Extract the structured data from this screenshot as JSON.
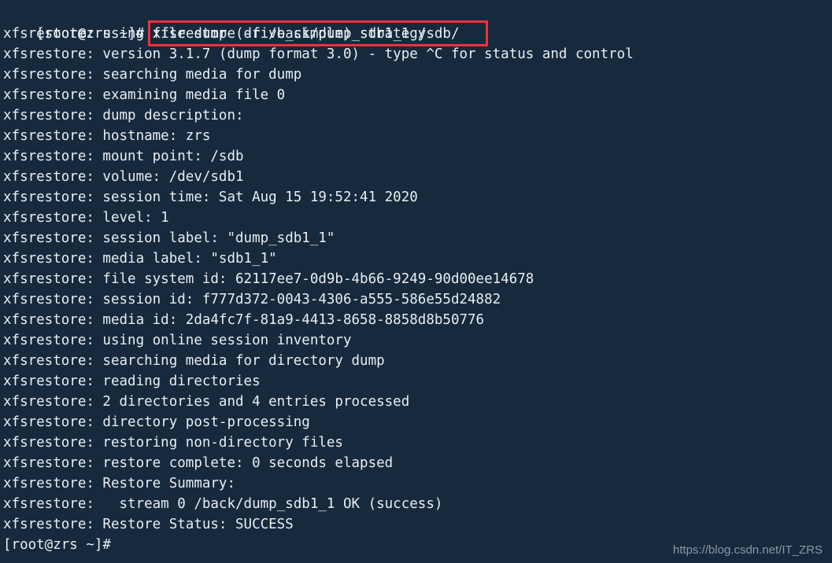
{
  "terminal": {
    "background_color": "#17293d",
    "text_color": "#e8eef2",
    "highlight_box_color": "#f3303c",
    "prompt": "[root@zrs ~]# ",
    "command": "xfsrestore -f /back/dump_sdb1_1 /sdb/",
    "output_lines": [
      "xfsrestore: using file dump (drive_simple) strategy",
      "xfsrestore: version 3.1.7 (dump format 3.0) - type ^C for status and control",
      "xfsrestore: searching media for dump",
      "xfsrestore: examining media file 0",
      "xfsrestore: dump description:",
      "xfsrestore: hostname: zrs",
      "xfsrestore: mount point: /sdb",
      "xfsrestore: volume: /dev/sdb1",
      "xfsrestore: session time: Sat Aug 15 19:52:41 2020",
      "xfsrestore: level: 1",
      "xfsrestore: session label: \"dump_sdb1_1\"",
      "xfsrestore: media label: \"sdb1_1\"",
      "xfsrestore: file system id: 62117ee7-0d9b-4b66-9249-90d00ee14678",
      "xfsrestore: session id: f777d372-0043-4306-a555-586e55d24882",
      "xfsrestore: media id: 2da4fc7f-81a9-4413-8658-8858d8b50776",
      "xfsrestore: using online session inventory",
      "xfsrestore: searching media for directory dump",
      "xfsrestore: reading directories",
      "xfsrestore: 2 directories and 4 entries processed",
      "xfsrestore: directory post-processing",
      "xfsrestore: restoring non-directory files",
      "xfsrestore: restore complete: 0 seconds elapsed",
      "xfsrestore: Restore Summary:",
      "xfsrestore:   stream 0 /back/dump_sdb1_1 OK (success)",
      "xfsrestore: Restore Status: SUCCESS"
    ],
    "final_prompt": "[root@zrs ~]#"
  },
  "watermark": {
    "text": "https://blog.csdn.net/IT_ZRS"
  }
}
